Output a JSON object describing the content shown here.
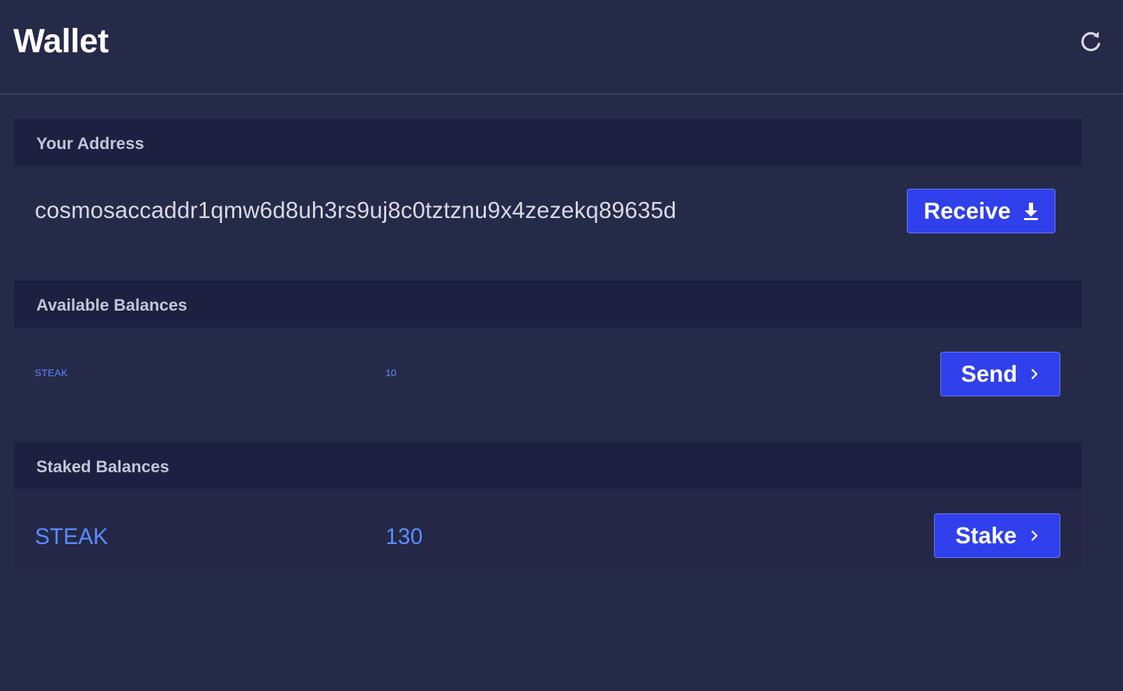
{
  "header": {
    "title": "Wallet",
    "refresh_icon": "refresh-icon"
  },
  "address_section": {
    "heading": "Your Address",
    "address": "cosmosaccaddr1qmw6d8uh3rs9uj8c0tztznu9x4zezekq89635d",
    "receive_label": "Receive",
    "receive_icon": "download-icon"
  },
  "available_section": {
    "heading": "Available Balances",
    "denom": "STEAK",
    "amount": "10",
    "send_label": "Send",
    "send_icon": "chevron-right-icon"
  },
  "staked_section": {
    "heading": "Staked Balances",
    "denom": "STEAK",
    "amount": "130",
    "stake_label": "Stake",
    "stake_icon": "chevron-right-icon"
  },
  "colors": {
    "background": "#262a49",
    "section_header": "#1d2040",
    "accent_button": "#3040ec",
    "link_blue": "#5c8cff"
  }
}
